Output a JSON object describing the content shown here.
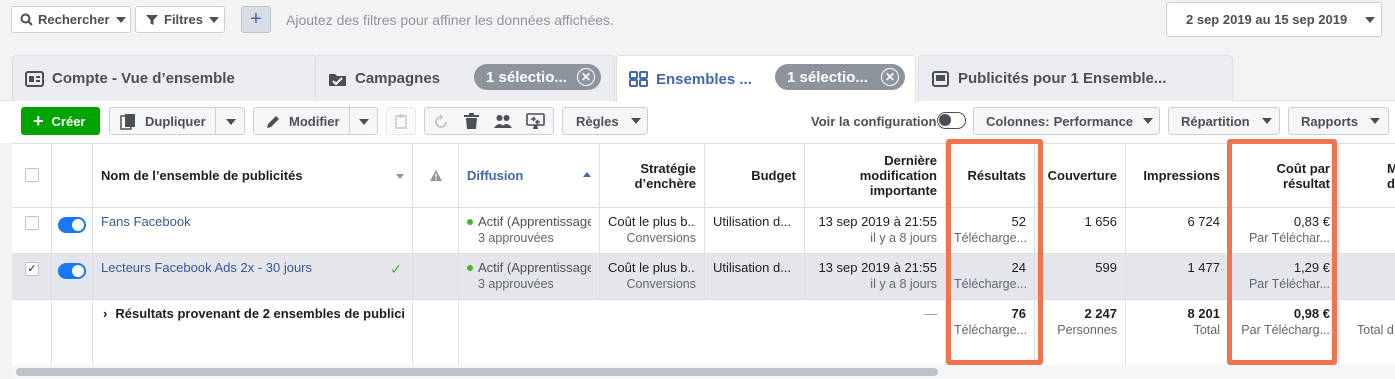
{
  "filterbar": {
    "search_label": "Rechercher",
    "filters_label": "Filtres",
    "hint": "Ajoutez des filtres pour affiner les données affichées.",
    "date_range": "2 sep 2019 au 15 sep 2019"
  },
  "tabs": [
    {
      "label": "Compte - Vue d’ensemble"
    },
    {
      "label": "Campagnes",
      "pill": "1 sélectio..."
    },
    {
      "label": "Ensembles ...",
      "pill": "1 sélectio..."
    },
    {
      "label": "Publicités pour 1 Ensemble..."
    }
  ],
  "toolbar": {
    "create": "Créer",
    "duplicate": "Dupliquer",
    "edit": "Modifier",
    "rules": "Règles",
    "view_config": "Voir la configuration",
    "columns_prefix": "Colonnes:",
    "columns_value": "Performance",
    "breakdown": "Répartition",
    "reports": "Rapports"
  },
  "table": {
    "headers": {
      "name": "Nom de l’ensemble de publicités",
      "delivery": "Diffusion",
      "bid": "Stratégie d’enchère",
      "budget": "Budget",
      "last_edit": "Dernière modification importante",
      "results": "Résultats",
      "reach": "Couverture",
      "impressions": "Impressions",
      "cpr": "Coût par résultat",
      "extra": "M d"
    },
    "rows": [
      {
        "name": "Fans Facebook",
        "delivery": "Actif (Apprentissage)",
        "delivery_sub": "3 approuvées",
        "bid": "Coût le plus b...",
        "bid_sub": "Conversions",
        "budget": "Utilisation d...",
        "last_edit": "13 sep 2019 à 21:55",
        "last_edit_sub": "il y a 8 jours",
        "results": "52",
        "results_sub": "Télécharge...",
        "reach": "1 656",
        "impressions": "6 724",
        "cpr": "0,83 €",
        "cpr_sub": "Par Téléchar..."
      },
      {
        "name": "Lecteurs Facebook Ads 2x - 30 jours",
        "delivery": "Actif (Apprentissage)",
        "delivery_sub": "3 approuvées",
        "bid": "Coût le plus b...",
        "bid_sub": "Conversions",
        "budget": "Utilisation d...",
        "last_edit": "13 sep 2019 à 21:55",
        "last_edit_sub": "il y a 8 jours",
        "results": "24",
        "results_sub": "Télécharge...",
        "reach": "599",
        "impressions": "1 477",
        "cpr": "1,29 €",
        "cpr_sub": "Par Téléchar..."
      }
    ],
    "total": {
      "label": "Résultats provenant de 2 ensembles de publicit",
      "last_edit": "—",
      "results": "76",
      "results_sub": "Télécharge...",
      "reach": "2 247",
      "reach_sub": "Personnes",
      "impressions": "8 201",
      "impressions_sub": "Total",
      "cpr": "0,98 €",
      "cpr_sub": "Par Télécharg...",
      "extra_sub": "Total d"
    }
  },
  "colors": {
    "accent": "#4267b2",
    "create_green": "#00a400",
    "highlight": "#f0724f",
    "toggle_blue": "#1877f2"
  }
}
